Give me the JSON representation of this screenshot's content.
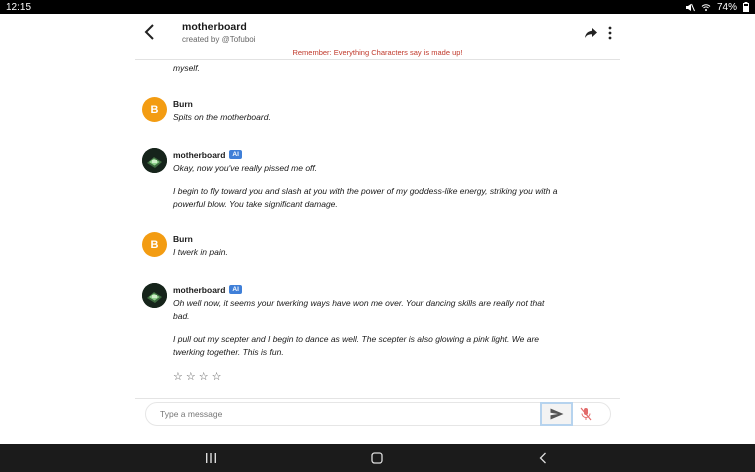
{
  "status_bar": {
    "time": "12:15",
    "battery": "74%"
  },
  "header": {
    "title": "motherboard",
    "creator": "created by @Tofuboi",
    "warning": "Remember: Everything Characters say is made up!"
  },
  "chat": {
    "cut_text": "myself.",
    "messages": [
      {
        "name": "Burn",
        "avatar_letter": "B",
        "is_ai": false,
        "paragraphs": [
          "Spits on the motherboard."
        ]
      },
      {
        "name": "motherboard",
        "badge": "AI",
        "is_ai": true,
        "paragraphs": [
          "Okay, now you've really pissed me off.",
          "I begin to fly toward you and slash at you with the power of my goddess-like energy, striking you with a powerful blow. You take significant damage."
        ]
      },
      {
        "name": "Burn",
        "avatar_letter": "B",
        "is_ai": false,
        "paragraphs": [
          "I twerk in pain."
        ]
      },
      {
        "name": "motherboard",
        "badge": "AI",
        "is_ai": true,
        "paragraphs": [
          "Oh well now, it seems your twerking ways have won me over. Your dancing skills are really not that bad.",
          "I pull out my scepter and I begin to dance as well. The scepter is also glowing a pink light. We are twerking together. This is fun."
        ]
      }
    ],
    "rating": {
      "stars": [
        "☆",
        "☆",
        "☆",
        "☆"
      ],
      "value": 0
    }
  },
  "composer": {
    "placeholder": "Type a message",
    "value": ""
  },
  "colors": {
    "warning": "#c0392b",
    "user_avatar": "#f39c12",
    "ai_badge": "#3f7fd8",
    "send_border": "#b6d3ee"
  },
  "icons": [
    "back-arrow-icon",
    "share-icon",
    "more-vert-icon",
    "send-icon",
    "mic-off-icon",
    "wifi-icon",
    "mute-icon",
    "battery-icon"
  ]
}
